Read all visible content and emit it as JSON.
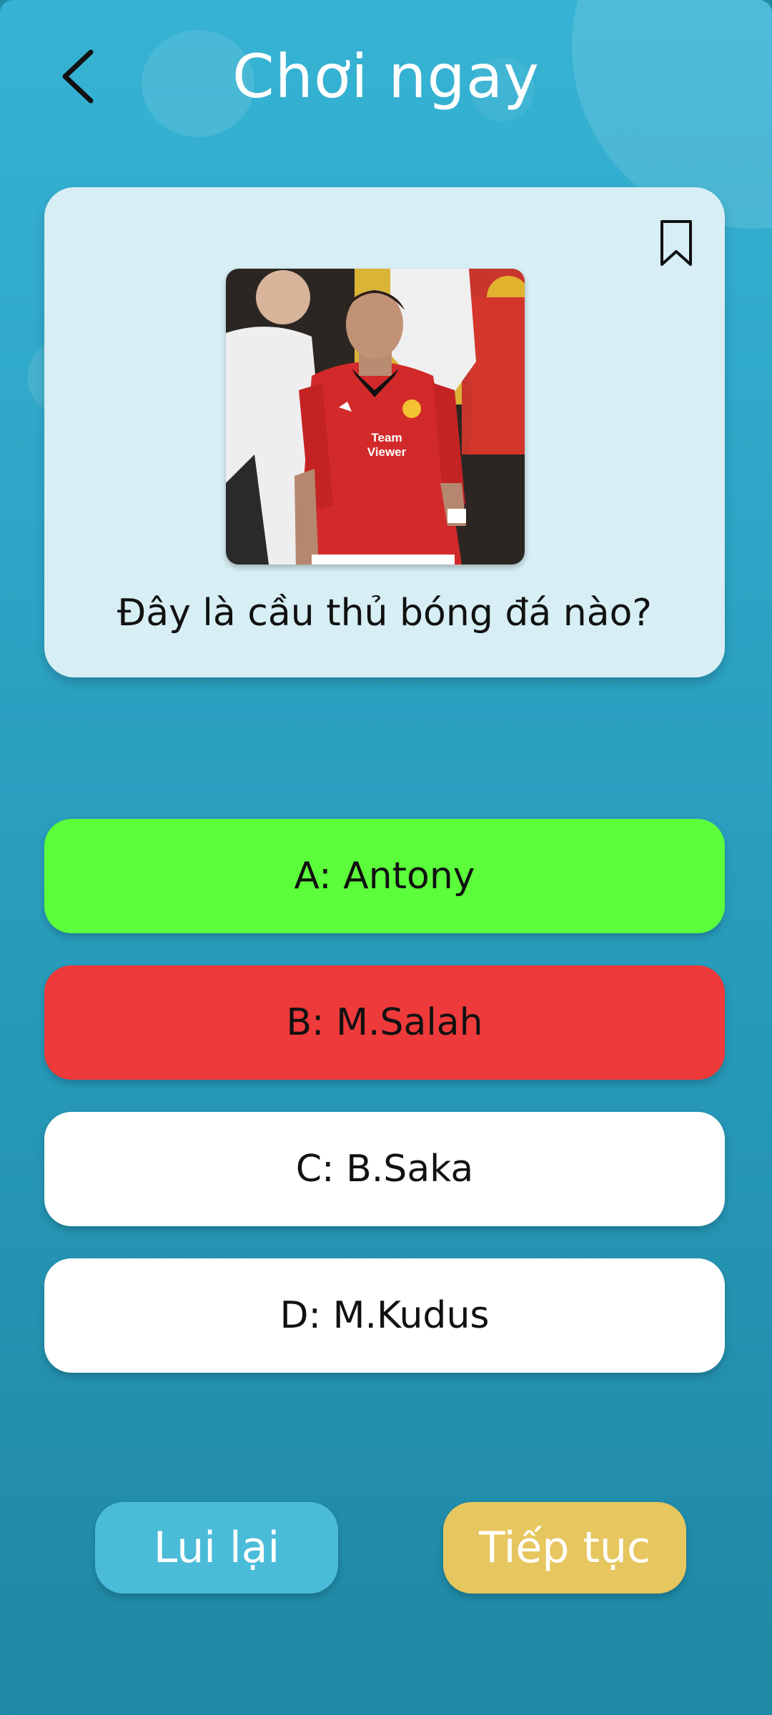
{
  "header": {
    "title": "Chơi ngay",
    "back_icon": "chevron-left-icon"
  },
  "question_card": {
    "bookmark_icon": "bookmark-icon",
    "image_name": "player-photo",
    "question": "Đây là cầu thủ bóng đá nào?"
  },
  "answers": [
    {
      "label": "A: Antony",
      "state": "correct",
      "color": "#5cfe3b"
    },
    {
      "label": "B: M.Salah",
      "state": "wrong",
      "color": "#ee3a3a"
    },
    {
      "label": "C: B.Saka",
      "state": "neutral",
      "color": "#ffffff"
    },
    {
      "label": "D: M.Kudus",
      "state": "neutral",
      "color": "#ffffff"
    }
  ],
  "footer": {
    "back_label": "Lui lại",
    "next_label": "Tiếp tục"
  },
  "colors": {
    "background": "#2a9fc0",
    "card": "#d6eef4",
    "back_button": "#4bbcd8",
    "next_button": "#e6c65f"
  }
}
